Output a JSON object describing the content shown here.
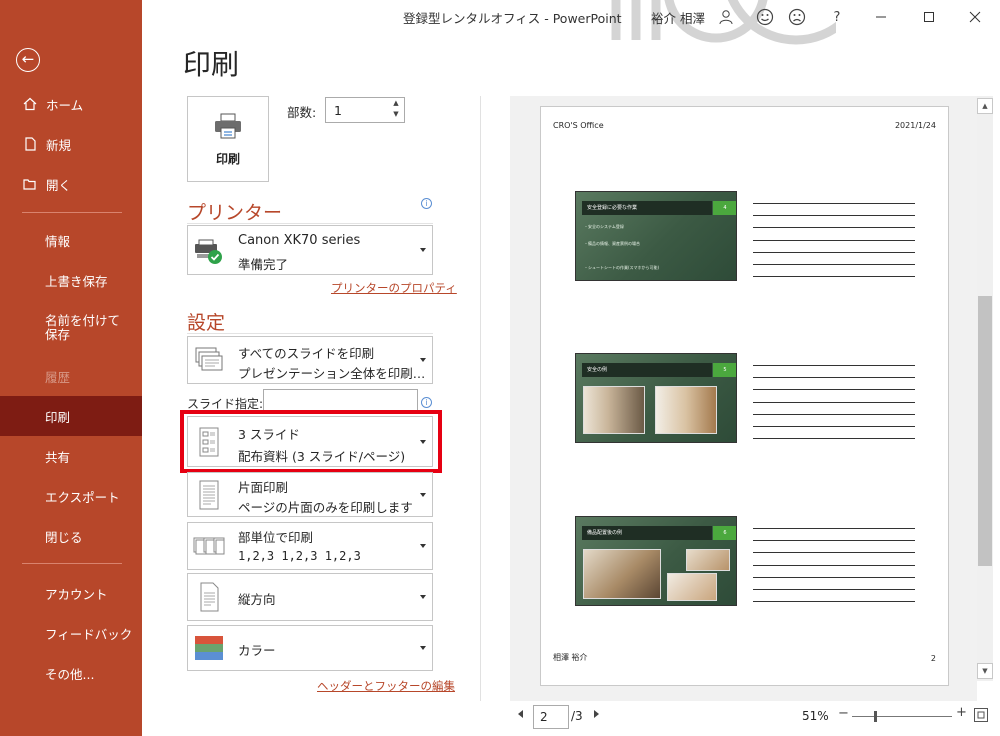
{
  "window": {
    "title": "登録型レンタルオフィス  -  PowerPoint",
    "user": "裕介 相澤",
    "help": "?"
  },
  "nav": {
    "items": [
      {
        "label": "ホーム",
        "icon": "home-icon"
      },
      {
        "label": "新規",
        "icon": "new-document-icon"
      },
      {
        "label": "開く",
        "icon": "folder-open-icon"
      },
      {
        "label": "情報"
      },
      {
        "label": "上書き保存"
      },
      {
        "label": "名前を付けて保存"
      },
      {
        "label": "履歴",
        "disabled": true
      },
      {
        "label": "印刷",
        "active": true
      },
      {
        "label": "共有"
      },
      {
        "label": "エクスポート"
      },
      {
        "label": "閉じる"
      },
      {
        "label": "アカウント"
      },
      {
        "label": "フィードバック"
      },
      {
        "label": "その他..."
      }
    ]
  },
  "print": {
    "title": "印刷",
    "print_button": "印刷",
    "copies_label": "部数:",
    "copies_value": "1"
  },
  "printer": {
    "heading": "プリンター",
    "name": "Canon XK70 series",
    "status": "準備完了",
    "properties_link": "プリンターのプロパティ"
  },
  "settings": {
    "heading": "設定",
    "range": {
      "line1": "すべてのスライドを印刷",
      "line2": "プレゼンテーション全体を印刷…"
    },
    "slides_label": "スライド指定:",
    "slides_value": "",
    "layout": {
      "line1": "3 スライド",
      "line2": "配布資料 (3 スライド/ページ)"
    },
    "sides": {
      "line1": "片面印刷",
      "line2": "ページの片面のみを印刷します"
    },
    "collate": {
      "line1": "部単位で印刷",
      "line2": "1,2,3   1,2,3   1,2,3"
    },
    "orientation": {
      "line1": "縦方向"
    },
    "color": {
      "line1": "カラー"
    },
    "header_footer_link": "ヘッダーとフッターの編集"
  },
  "preview": {
    "header_left": "CRO'S Office",
    "header_right": "2021/1/24",
    "footer_left": "相澤 裕介",
    "footer_right": "2",
    "slides": [
      {
        "title": "安全登録に必要な作業",
        "number": "4",
        "lines": [
          "・安全のシステム登録",
          "・備品の情報、資産票例の場合",
          "・シュートシートの作業(スマホから可能)"
        ]
      },
      {
        "title": "安全の例",
        "number": "5"
      },
      {
        "title": "備品配置後の例",
        "number": "6"
      }
    ]
  },
  "pager": {
    "current": "2",
    "total": "/3",
    "zoom": "51%",
    "zoom_minus": "−",
    "zoom_plus": "+"
  }
}
